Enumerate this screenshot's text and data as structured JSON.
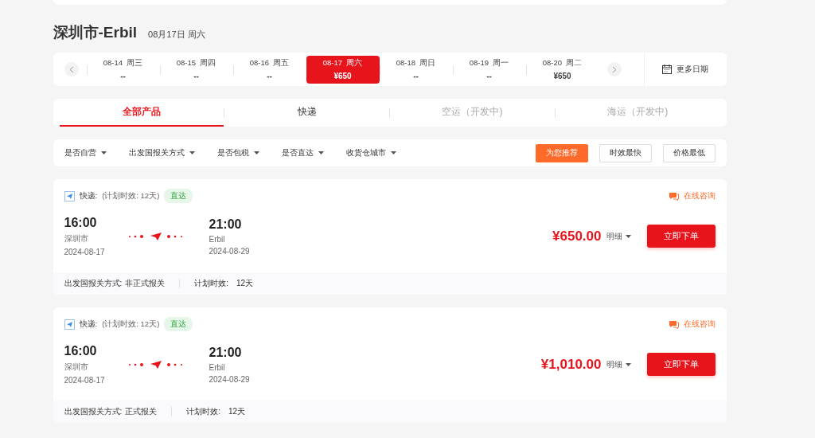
{
  "header": {
    "route": "深圳市-Erbil",
    "date": "08月17日 周六"
  },
  "dates": [
    {
      "date": "08-14",
      "weekday": "周三",
      "price": "--",
      "selected": false
    },
    {
      "date": "08-15",
      "weekday": "周四",
      "price": "--",
      "selected": false
    },
    {
      "date": "08-16",
      "weekday": "周五",
      "price": "--",
      "selected": false
    },
    {
      "date": "08-17",
      "weekday": "周六",
      "price": "¥650",
      "selected": true
    },
    {
      "date": "08-18",
      "weekday": "周日",
      "price": "--",
      "selected": false
    },
    {
      "date": "08-19",
      "weekday": "周一",
      "price": "--",
      "selected": false
    },
    {
      "date": "08-20",
      "weekday": "周二",
      "price": "¥650",
      "selected": false
    }
  ],
  "more_dates": "更多日期",
  "tabs": [
    {
      "label": "全部产品",
      "selected": true,
      "disabled": false
    },
    {
      "label": "快递",
      "selected": false,
      "disabled": false
    },
    {
      "label": "空运（开发中)",
      "selected": false,
      "disabled": true
    },
    {
      "label": "海运（开发中)",
      "selected": false,
      "disabled": true
    }
  ],
  "filters": [
    "是否自营",
    "出发国报关方式",
    "是否包税",
    "是否直达",
    "收货仓城市"
  ],
  "sorts": [
    {
      "label": "为您推荐",
      "selected": true
    },
    {
      "label": "时效最快",
      "selected": false
    },
    {
      "label": "价格最低",
      "selected": false
    }
  ],
  "offers": [
    {
      "service": "快递:",
      "plan": "(计划时效: 12天)",
      "tag": "直达",
      "consult": "在线咨询",
      "depart_time": "16:00",
      "depart_city": "深圳市",
      "depart_date": "2024-08-17",
      "arrive_time": "21:00",
      "arrive_city": "Erbil",
      "arrive_date": "2024-08-29",
      "price": "¥650.00",
      "detail": "明细",
      "order": "立即下单",
      "customs_label": "出发国报关方式:",
      "customs": "非正式报关",
      "time_label": "计划时效:",
      "time": "12天"
    },
    {
      "service": "快递:",
      "plan": "(计划时效: 12天)",
      "tag": "直达",
      "consult": "在线咨询",
      "depart_time": "16:00",
      "depart_city": "深圳市",
      "depart_date": "2024-08-17",
      "arrive_time": "21:00",
      "arrive_city": "Erbil",
      "arrive_date": "2024-08-29",
      "price": "¥1,010.00",
      "detail": "明细",
      "order": "立即下单",
      "customs_label": "出发国报关方式:",
      "customs": "正式报关",
      "time_label": "计划时效:",
      "time": "12天"
    }
  ]
}
